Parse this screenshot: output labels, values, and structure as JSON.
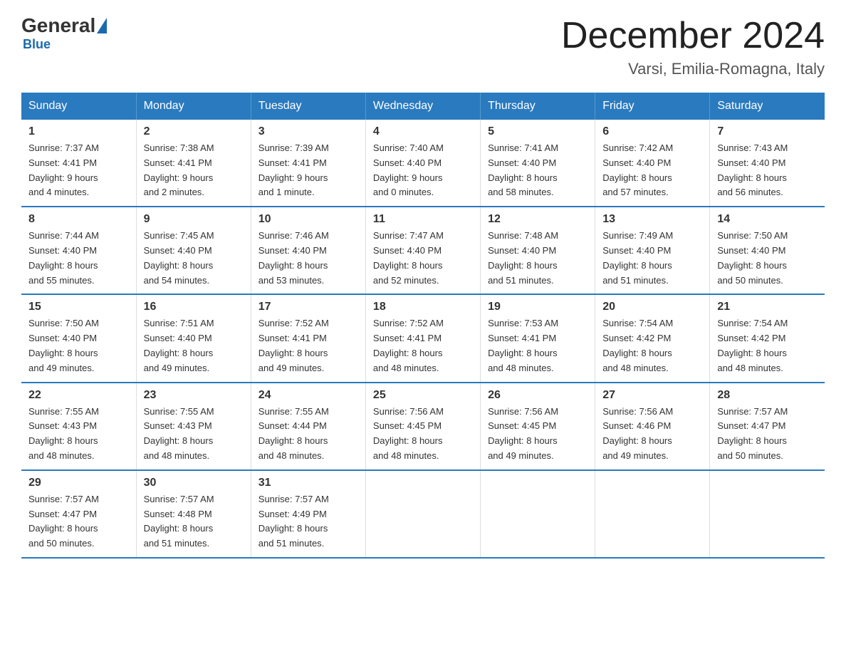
{
  "header": {
    "logo_general": "General",
    "logo_blue": "Blue",
    "month": "December 2024",
    "location": "Varsi, Emilia-Romagna, Italy"
  },
  "days_of_week": [
    "Sunday",
    "Monday",
    "Tuesday",
    "Wednesday",
    "Thursday",
    "Friday",
    "Saturday"
  ],
  "weeks": [
    [
      {
        "day": "1",
        "sunrise": "7:37 AM",
        "sunset": "4:41 PM",
        "daylight": "9 hours and 4 minutes."
      },
      {
        "day": "2",
        "sunrise": "7:38 AM",
        "sunset": "4:41 PM",
        "daylight": "9 hours and 2 minutes."
      },
      {
        "day": "3",
        "sunrise": "7:39 AM",
        "sunset": "4:41 PM",
        "daylight": "9 hours and 1 minute."
      },
      {
        "day": "4",
        "sunrise": "7:40 AM",
        "sunset": "4:40 PM",
        "daylight": "9 hours and 0 minutes."
      },
      {
        "day": "5",
        "sunrise": "7:41 AM",
        "sunset": "4:40 PM",
        "daylight": "8 hours and 58 minutes."
      },
      {
        "day": "6",
        "sunrise": "7:42 AM",
        "sunset": "4:40 PM",
        "daylight": "8 hours and 57 minutes."
      },
      {
        "day": "7",
        "sunrise": "7:43 AM",
        "sunset": "4:40 PM",
        "daylight": "8 hours and 56 minutes."
      }
    ],
    [
      {
        "day": "8",
        "sunrise": "7:44 AM",
        "sunset": "4:40 PM",
        "daylight": "8 hours and 55 minutes."
      },
      {
        "day": "9",
        "sunrise": "7:45 AM",
        "sunset": "4:40 PM",
        "daylight": "8 hours and 54 minutes."
      },
      {
        "day": "10",
        "sunrise": "7:46 AM",
        "sunset": "4:40 PM",
        "daylight": "8 hours and 53 minutes."
      },
      {
        "day": "11",
        "sunrise": "7:47 AM",
        "sunset": "4:40 PM",
        "daylight": "8 hours and 52 minutes."
      },
      {
        "day": "12",
        "sunrise": "7:48 AM",
        "sunset": "4:40 PM",
        "daylight": "8 hours and 51 minutes."
      },
      {
        "day": "13",
        "sunrise": "7:49 AM",
        "sunset": "4:40 PM",
        "daylight": "8 hours and 51 minutes."
      },
      {
        "day": "14",
        "sunrise": "7:50 AM",
        "sunset": "4:40 PM",
        "daylight": "8 hours and 50 minutes."
      }
    ],
    [
      {
        "day": "15",
        "sunrise": "7:50 AM",
        "sunset": "4:40 PM",
        "daylight": "8 hours and 49 minutes."
      },
      {
        "day": "16",
        "sunrise": "7:51 AM",
        "sunset": "4:40 PM",
        "daylight": "8 hours and 49 minutes."
      },
      {
        "day": "17",
        "sunrise": "7:52 AM",
        "sunset": "4:41 PM",
        "daylight": "8 hours and 49 minutes."
      },
      {
        "day": "18",
        "sunrise": "7:52 AM",
        "sunset": "4:41 PM",
        "daylight": "8 hours and 48 minutes."
      },
      {
        "day": "19",
        "sunrise": "7:53 AM",
        "sunset": "4:41 PM",
        "daylight": "8 hours and 48 minutes."
      },
      {
        "day": "20",
        "sunrise": "7:54 AM",
        "sunset": "4:42 PM",
        "daylight": "8 hours and 48 minutes."
      },
      {
        "day": "21",
        "sunrise": "7:54 AM",
        "sunset": "4:42 PM",
        "daylight": "8 hours and 48 minutes."
      }
    ],
    [
      {
        "day": "22",
        "sunrise": "7:55 AM",
        "sunset": "4:43 PM",
        "daylight": "8 hours and 48 minutes."
      },
      {
        "day": "23",
        "sunrise": "7:55 AM",
        "sunset": "4:43 PM",
        "daylight": "8 hours and 48 minutes."
      },
      {
        "day": "24",
        "sunrise": "7:55 AM",
        "sunset": "4:44 PM",
        "daylight": "8 hours and 48 minutes."
      },
      {
        "day": "25",
        "sunrise": "7:56 AM",
        "sunset": "4:45 PM",
        "daylight": "8 hours and 48 minutes."
      },
      {
        "day": "26",
        "sunrise": "7:56 AM",
        "sunset": "4:45 PM",
        "daylight": "8 hours and 49 minutes."
      },
      {
        "day": "27",
        "sunrise": "7:56 AM",
        "sunset": "4:46 PM",
        "daylight": "8 hours and 49 minutes."
      },
      {
        "day": "28",
        "sunrise": "7:57 AM",
        "sunset": "4:47 PM",
        "daylight": "8 hours and 50 minutes."
      }
    ],
    [
      {
        "day": "29",
        "sunrise": "7:57 AM",
        "sunset": "4:47 PM",
        "daylight": "8 hours and 50 minutes."
      },
      {
        "day": "30",
        "sunrise": "7:57 AM",
        "sunset": "4:48 PM",
        "daylight": "8 hours and 51 minutes."
      },
      {
        "day": "31",
        "sunrise": "7:57 AM",
        "sunset": "4:49 PM",
        "daylight": "8 hours and 51 minutes."
      },
      null,
      null,
      null,
      null
    ]
  ],
  "labels": {
    "sunrise": "Sunrise:",
    "sunset": "Sunset:",
    "daylight": "Daylight:"
  }
}
